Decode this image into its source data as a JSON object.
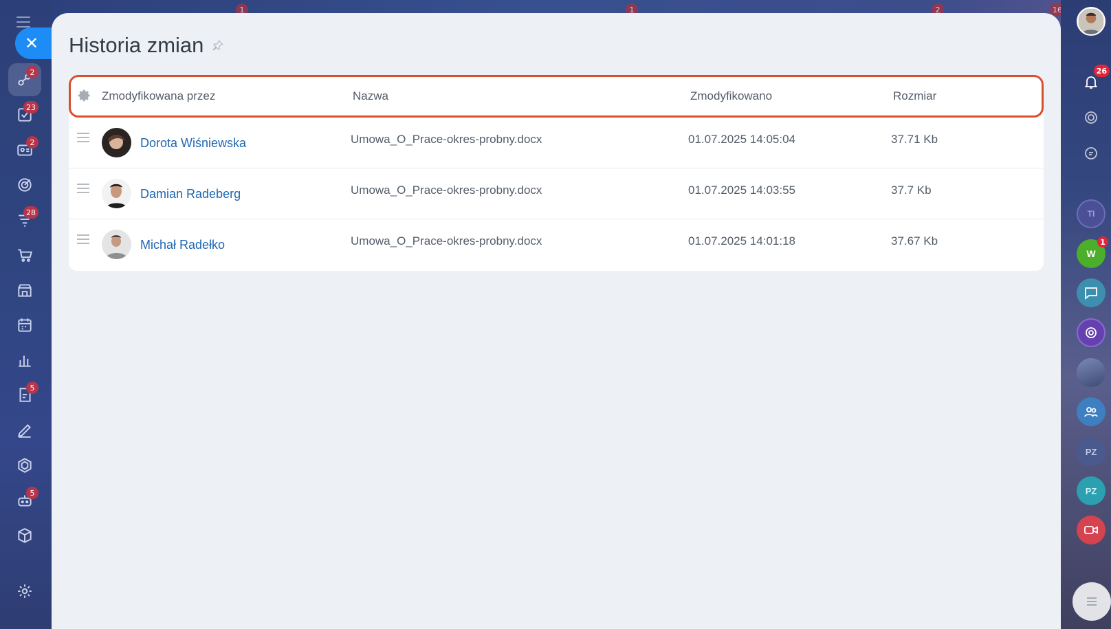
{
  "page": {
    "title": "Historia zmian"
  },
  "left_nav": {
    "items": [
      {
        "icon": "activity-stream-icon",
        "badge": "2"
      },
      {
        "icon": "tasks-icon",
        "badge": "23"
      },
      {
        "icon": "crm-icon",
        "badge": "2"
      },
      {
        "icon": "target-icon",
        "badge": ""
      },
      {
        "icon": "funnel-icon",
        "badge": "28"
      },
      {
        "icon": "cart-icon",
        "badge": ""
      },
      {
        "icon": "store-icon",
        "badge": ""
      },
      {
        "icon": "calendar-icon",
        "badge": ""
      },
      {
        "icon": "analytics-icon",
        "badge": ""
      },
      {
        "icon": "documents-icon",
        "badge": "5"
      },
      {
        "icon": "sign-icon",
        "badge": ""
      },
      {
        "icon": "hexagon-icon",
        "badge": ""
      },
      {
        "icon": "bot-icon",
        "badge": "5"
      },
      {
        "icon": "package-icon",
        "badge": ""
      },
      {
        "icon": "settings-icon",
        "badge": ""
      }
    ]
  },
  "top_badges": [
    "1",
    "1",
    "2",
    "16"
  ],
  "right_bar": {
    "notifications_badge": "26",
    "avatar_initials": [
      "TI",
      "W",
      "PZ",
      "PZ"
    ],
    "w_badge": "1"
  },
  "grid": {
    "columns": {
      "modified_by": "Zmodyfikowana przez",
      "name": "Nazwa",
      "modified": "Zmodyfikowano",
      "size": "Rozmiar"
    },
    "rows": [
      {
        "user": "Dorota Wiśniewska",
        "name": "Umowa_O_Prace-okres-probny.docx",
        "modified": "01.07.2025 14:05:04",
        "size": "37.71 Kb"
      },
      {
        "user": "Damian Radeberg",
        "name": "Umowa_O_Prace-okres-probny.docx",
        "modified": "01.07.2025 14:03:55",
        "size": "37.7 Kb"
      },
      {
        "user": "Michał Radełko",
        "name": "Umowa_O_Prace-okres-probny.docx",
        "modified": "01.07.2025 14:01:18",
        "size": "37.67 Kb"
      }
    ]
  },
  "colors": {
    "accent": "#1e8cf5",
    "highlight_border": "#d94f2c",
    "link": "#2067b0"
  }
}
